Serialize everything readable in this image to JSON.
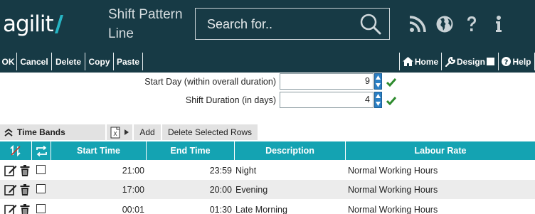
{
  "header": {
    "logo_text": "agilit",
    "page_title": "Shift Pattern Line",
    "search_placeholder": "Search for..",
    "icons": [
      "rss-icon",
      "globe-icon",
      "help-icon",
      "info-icon"
    ]
  },
  "toolbar": {
    "ok": "OK",
    "cancel": "Cancel",
    "delete": "Delete",
    "copy": "Copy",
    "paste": "Paste",
    "home": "Home",
    "design": "Design",
    "help": "Help"
  },
  "form": {
    "start_day_label": "Start Day (within overall duration)",
    "start_day_value": "9",
    "shift_duration_label": "Shift Duration (in days)",
    "shift_duration_value": "4"
  },
  "time_bands": {
    "title": "Time Bands",
    "add": "Add",
    "delete_selected": "Delete Selected Rows",
    "columns": [
      "Start Time",
      "End Time",
      "Description",
      "Labour Rate"
    ],
    "rows": [
      {
        "start": "21:00",
        "end": "23:59",
        "description": "Night",
        "labour_rate": "Normal Working Hours"
      },
      {
        "start": "17:00",
        "end": "20:00",
        "description": "Evening",
        "labour_rate": "Normal Working Hours"
      },
      {
        "start": "00:01",
        "end": "01:30",
        "description": "Late Morning",
        "labour_rate": "Normal Working Hours"
      }
    ]
  },
  "colors": {
    "header_bg": "#173a45",
    "grid_header": "#14a3b2",
    "accent_blue": "#2a7fc4",
    "check_green": "#2e8b2e",
    "logo_slash": "#27b5c4"
  }
}
